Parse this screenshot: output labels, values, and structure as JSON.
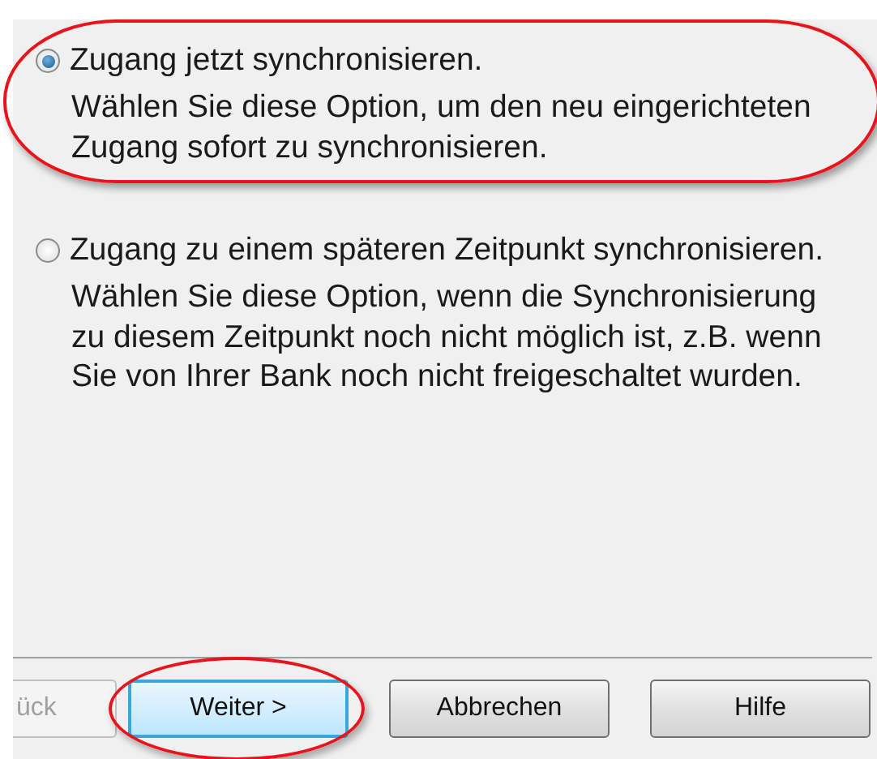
{
  "options": [
    {
      "label": "Zugang jetzt synchronisieren.",
      "description": "Wählen Sie diese Option, um den neu eingerichteten\nZugang sofort zu synchronisieren.",
      "selected": true,
      "highlighted": true
    },
    {
      "label": "Zugang zu einem späteren Zeitpunkt synchronisieren.",
      "description": "Wählen Sie diese Option, wenn die Synchronisierung\nzu diesem Zeitpunkt noch nicht möglich ist, z.B. wenn\nSie von Ihrer Bank noch nicht freigeschaltet wurden.",
      "selected": false,
      "highlighted": false
    }
  ],
  "buttons": [
    {
      "label": "ück",
      "disabled": true,
      "focused": false,
      "highlighted": false
    },
    {
      "label": "Weiter >",
      "disabled": false,
      "focused": true,
      "highlighted": true
    },
    {
      "label": "Abbrechen",
      "disabled": false,
      "focused": false,
      "highlighted": false
    },
    {
      "label": "Hilfe",
      "disabled": false,
      "focused": false,
      "highlighted": false
    }
  ]
}
